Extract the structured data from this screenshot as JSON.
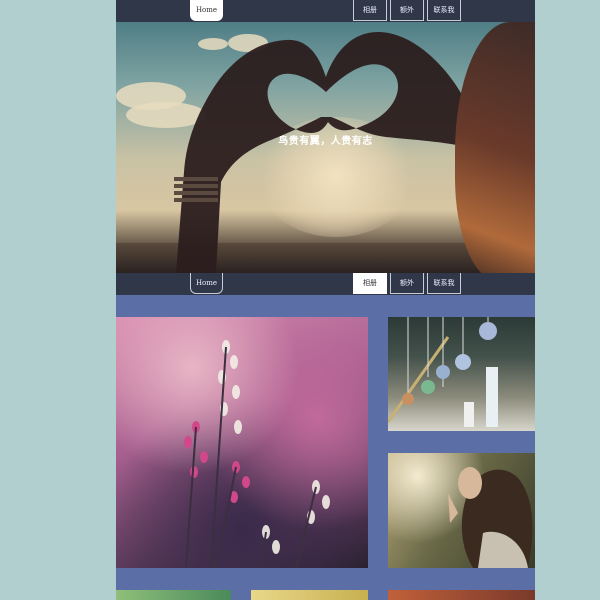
{
  "nav_top": {
    "home": "Home",
    "album": "相册",
    "outside": "额外",
    "contact": "联系我"
  },
  "nav_mid": {
    "home": "Home",
    "album": "相册",
    "outside": "额外",
    "contact": "联系我"
  },
  "hero": {
    "slogan": "鸟贵有翼，人贵有志"
  },
  "colors": {
    "background": "#b2cfd0",
    "nav": "#2f3748",
    "content": "#5b6fa6",
    "active": "#ffffff"
  }
}
